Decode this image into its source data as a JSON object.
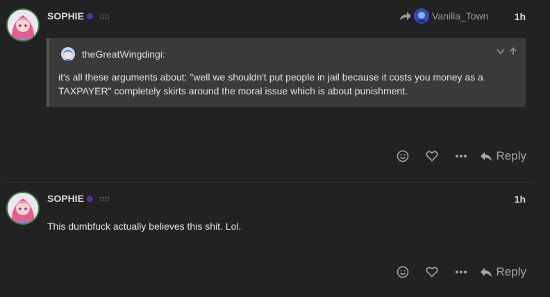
{
  "posts": [
    {
      "username": "SOPHIE",
      "flair": "□□",
      "time": "1h",
      "reply_to": {
        "username": "Vanilla_Town"
      },
      "quote": {
        "author": "theGreatWingdingi:",
        "text": "it's all these arguments about: \"well we shouldn't put people in jail because it costs you money as a TAXPAYER\" completely skirts around the moral issue which is about punishment."
      },
      "actions": {
        "reply_label": "Reply"
      }
    },
    {
      "username": "SOPHIE",
      "flair": "□□",
      "time": "1h",
      "body": "This dumbfuck actually believes this shit. Lol.",
      "actions": {
        "reply_label": "Reply"
      }
    }
  ],
  "icons": {
    "reply_to": "share-arrow-icon",
    "quote_controls": [
      "chevron-down-icon",
      "arrow-up-icon"
    ],
    "actions": [
      "smile-icon",
      "heart-icon",
      "ellipsis-icon",
      "reply-icon"
    ]
  },
  "colors": {
    "background": "#222222",
    "quote_bg": "#3a3a3a",
    "badge": "#5b2fa8",
    "avatar_border": "#2e7d32"
  }
}
